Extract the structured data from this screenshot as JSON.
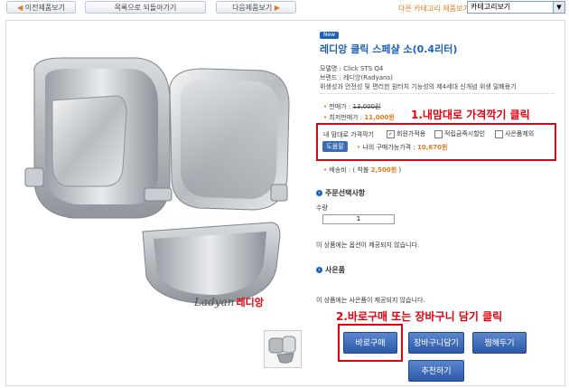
{
  "topnav": {
    "prev_label": "이전제품보기",
    "list_label": "목록으로 되돌아가기",
    "next_label": "다음제품보기",
    "other_category_label": "다른 카테고리 제품보기",
    "category_select_value": "카테고리보기"
  },
  "product": {
    "badge": "New",
    "name": "레디앙 클릭 스페샬 소(0.4리터)",
    "model": "모델명 : Click STS Q4",
    "brand": "브랜드 : 레디앙(Radyans)",
    "description": "위생성과 안전성 및 편리한 원터치 기능성의 제4세대 신개념 위생 밀폐용기",
    "logo_text": "Ladyan",
    "logo_korean": "레디앙",
    "price_label": "판매가 :",
    "price_value": "13,000원",
    "lowest_label": "최저판매가 :",
    "lowest_value": "11,000원"
  },
  "pricing_options": {
    "label": "내 맘대로 가격깍기",
    "opt1": "회원가적용",
    "opt2": "적립금즉시할인",
    "opt3": "사은품제외",
    "calc_button": "도움말",
    "my_price_label": "나의 구매가능가격 :",
    "my_price_value": "10,670원",
    "shipping_label": "배송비 : ( 착불",
    "shipping_value": "2,500원",
    "shipping_suffix": ")"
  },
  "annotations": {
    "step1": "1.내맘대로 가격깍기 클릭",
    "step2": "2.바로구매 또는 장바구니 담기 클릭"
  },
  "order": {
    "section_title": "주문선택사항",
    "qty_label": "수량",
    "qty_value": "1",
    "no_option_text": "이 상품에는 옵션이 제공되지 않습니다.",
    "gift_title": "사은품",
    "no_gift_text": "이 상품에는 사은품이 제공되지 않습니다."
  },
  "buttons": {
    "buy_now": "바로구매",
    "cart": "장바구니담기",
    "wishlist": "찜해두기",
    "recommend": "추천하기"
  },
  "colors": {
    "accent_blue": "#1e62b8",
    "accent_orange": "#e07b18",
    "annotation_red": "#e6000d"
  }
}
